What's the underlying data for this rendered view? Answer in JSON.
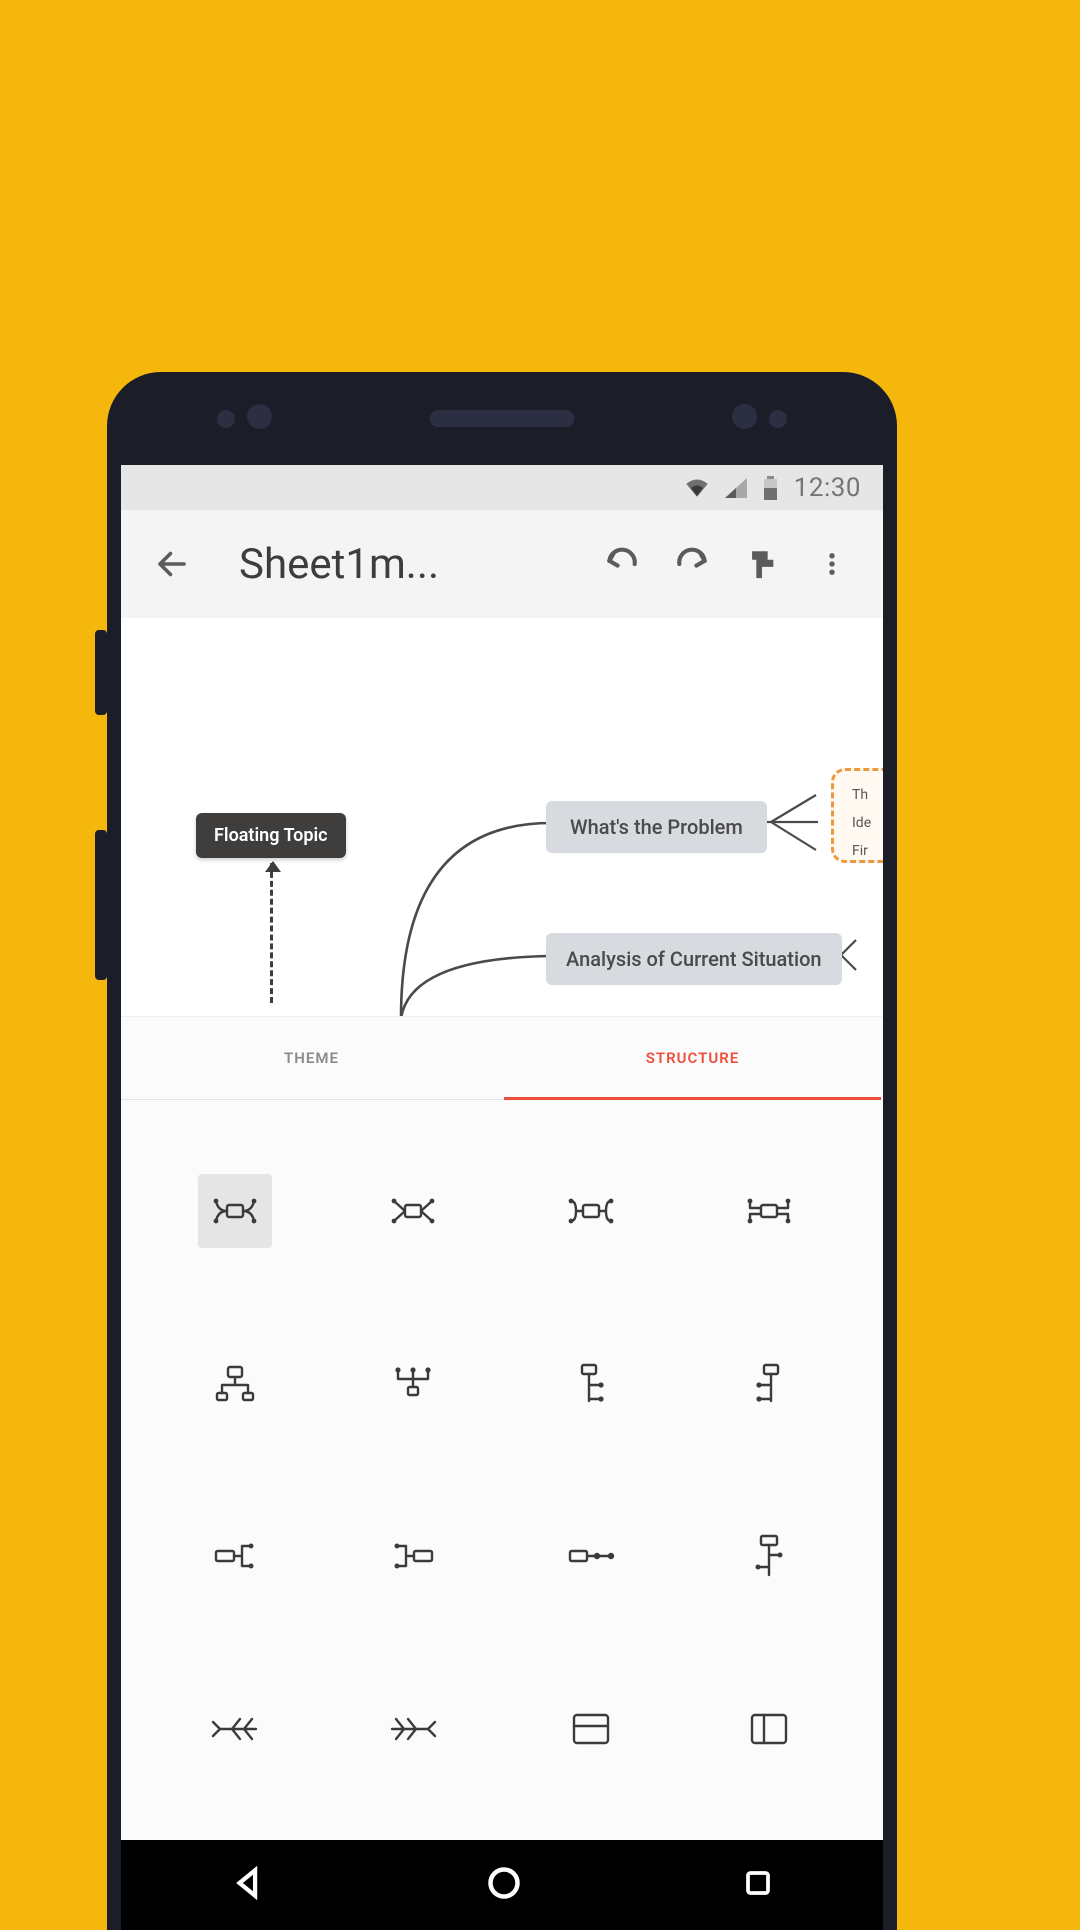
{
  "status": {
    "time": "12:30"
  },
  "appbar": {
    "title": "Sheet1m..."
  },
  "canvas": {
    "floating_label": "Floating Topic",
    "node1": "What's the Problem",
    "node2": "Analysis of Current Situation",
    "side_items": [
      "Th",
      "Ide",
      "Fir"
    ]
  },
  "panel": {
    "tabs": {
      "theme": "THEME",
      "structure": "STRUCTURE"
    },
    "active_tab": "structure"
  }
}
